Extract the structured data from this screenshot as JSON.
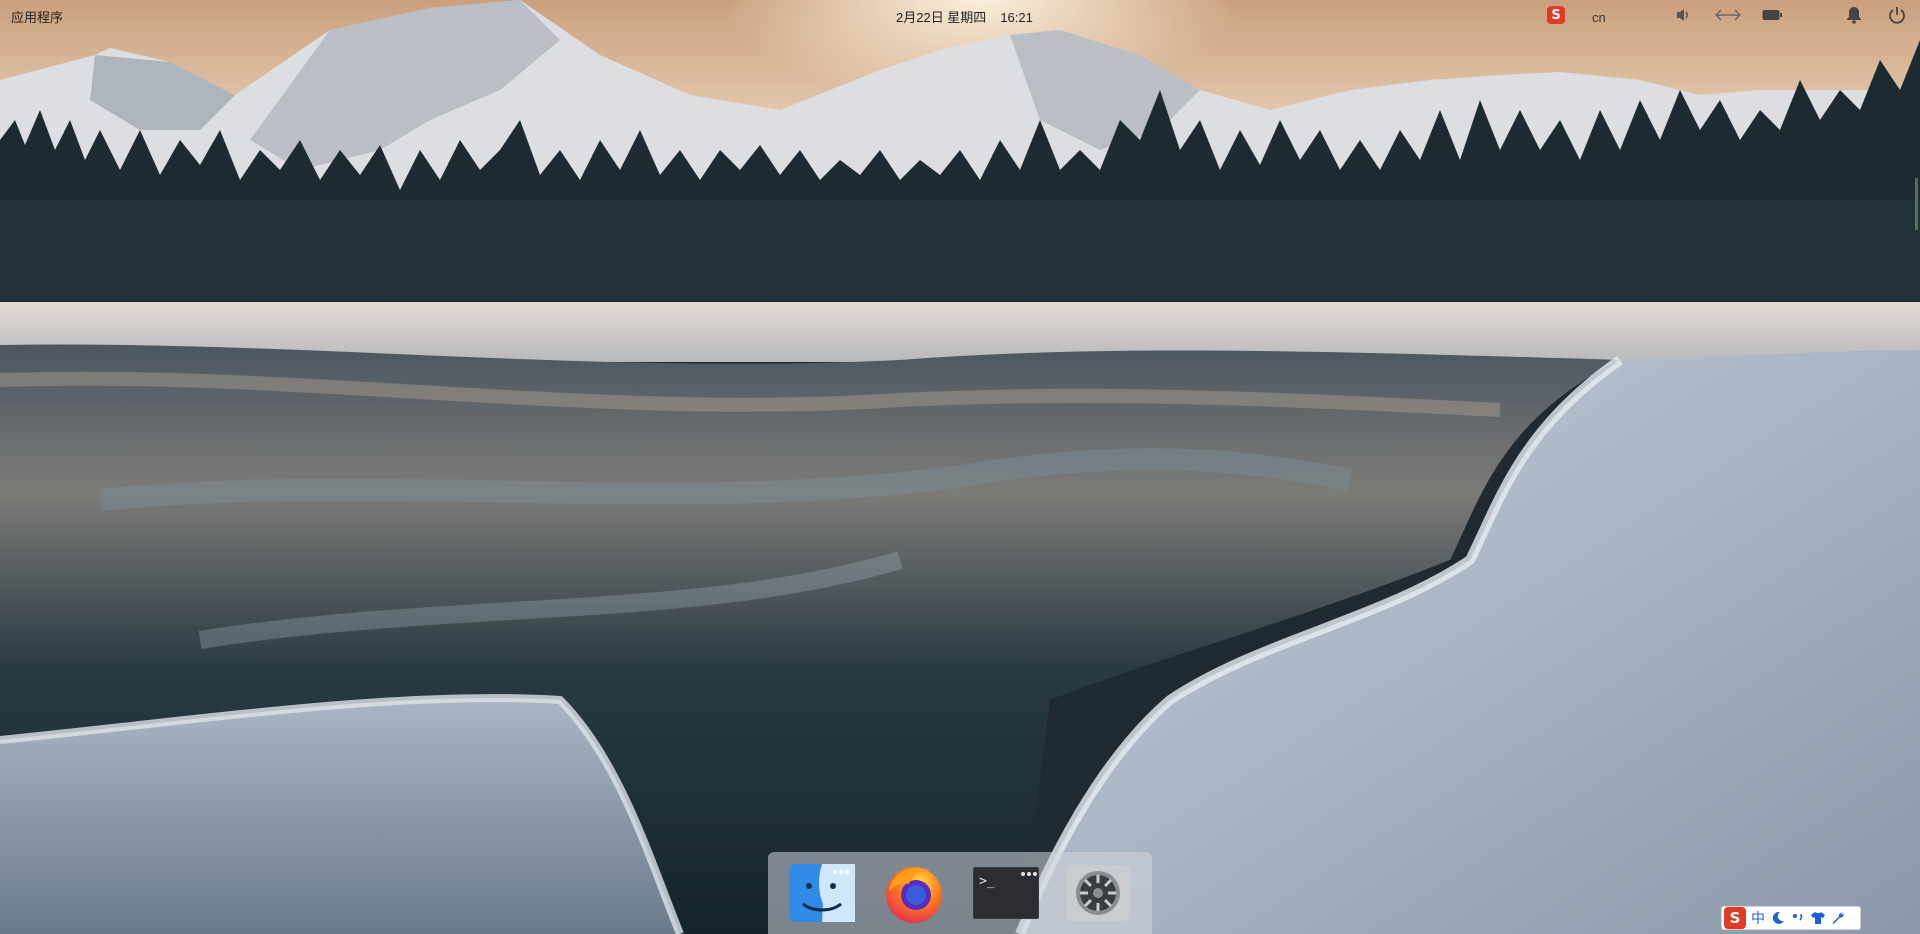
{
  "topbar": {
    "apps_menu_label": "应用程序",
    "date": "2月22日 星期四",
    "time": "16:21",
    "lang_label": "cn",
    "icons": [
      "sogou-input-icon",
      "volume-icon",
      "network-icon",
      "battery-icon",
      "notification-bell-icon",
      "power-icon"
    ]
  },
  "dock": {
    "items": [
      {
        "name": "finder",
        "icon": "finder-icon"
      },
      {
        "name": "firefox",
        "icon": "firefox-icon"
      },
      {
        "name": "terminal",
        "icon": "terminal-icon"
      },
      {
        "name": "system-settings",
        "icon": "gear-icon"
      }
    ],
    "terminal_prompt": ">_"
  },
  "ime_bar": {
    "mode_label": "中",
    "icons": [
      "sogou-logo-icon",
      "moon-icon",
      "punctuation-icon",
      "skin-shirt-icon",
      "wrench-icon"
    ]
  },
  "colors": {
    "sogou_red": "#e23b25",
    "ime_blue": "#1c5fd6",
    "dock_bg": "rgba(210,214,220,0.55)"
  }
}
